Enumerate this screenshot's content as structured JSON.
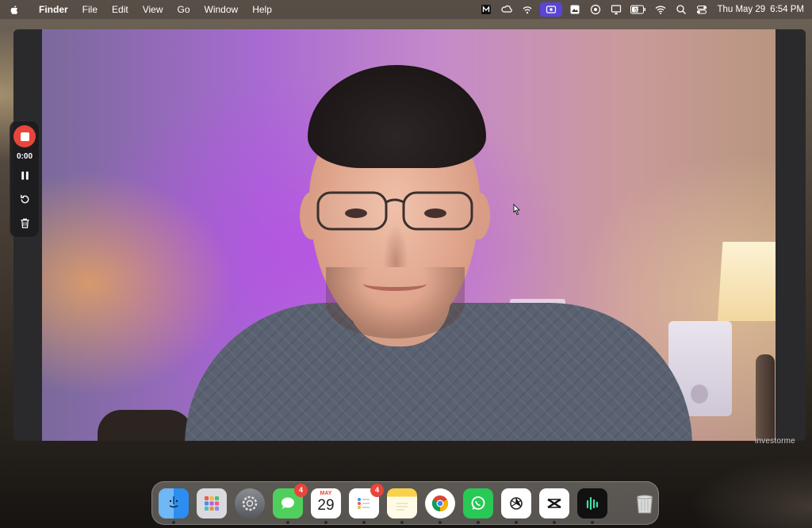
{
  "menubar": {
    "app_name": "Finder",
    "items": [
      "File",
      "Edit",
      "View",
      "Go",
      "Window",
      "Help"
    ],
    "clock": {
      "date": "Thu May 29",
      "time": "6:54 PM"
    }
  },
  "status_icons": [
    "m-app-icon",
    "creative-cloud-icon",
    "airplay-icon",
    "screen-recorder-icon",
    "mountain-icon",
    "vpn-icon",
    "display-icon",
    "battery-icon",
    "wifi-icon",
    "search-icon",
    "control-center-icon"
  ],
  "battery_label": "52",
  "recorder": {
    "timer": "0:00",
    "accent": "#e8453c"
  },
  "video": {
    "watermark": "investorme"
  },
  "dock": {
    "calendar": {
      "month": "MAY",
      "day": "29"
    },
    "messages_badge": "4",
    "reminders_badge": "4",
    "apps": [
      "finder",
      "launchpad",
      "system-settings",
      "messages",
      "calendar",
      "reminders",
      "notes",
      "chrome",
      "whatsapp",
      "chatgpt",
      "capcut",
      "audio-app",
      "trash"
    ]
  }
}
